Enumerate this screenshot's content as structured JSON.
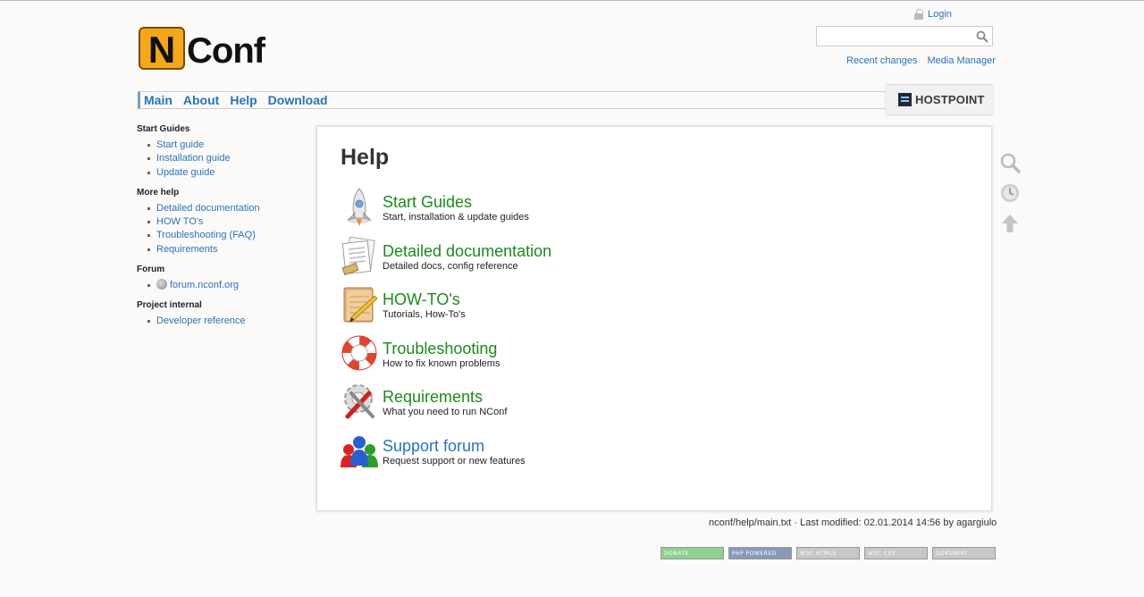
{
  "header": {
    "logo_text": "NConf",
    "login_label": "Login",
    "search": {
      "value": "",
      "placeholder": ""
    },
    "usertools": [
      "Recent changes",
      "Media Manager"
    ]
  },
  "menu": [
    "Main",
    "About",
    "Help",
    "Download"
  ],
  "sponsor": "HOSTPOINT",
  "sidebar": {
    "sections": [
      {
        "title": "Start Guides",
        "items": [
          "Start guide",
          "Installation guide",
          "Update guide"
        ]
      },
      {
        "title": "More help",
        "items": [
          "Detailed documentation",
          "HOW TO's",
          "Troubleshooting (FAQ)",
          "Requirements"
        ]
      },
      {
        "title": "Forum",
        "items": [
          "forum.nconf.org"
        ]
      },
      {
        "title": "Project internal",
        "items": [
          "Developer reference"
        ]
      }
    ]
  },
  "main": {
    "title": "Help",
    "entries": [
      {
        "title": "Start Guides",
        "subtitle": "Start, installation & update guides",
        "icon": "rocket-icon"
      },
      {
        "title": "Detailed documentation",
        "subtitle": "Detailed docs, config reference",
        "icon": "documents-icon"
      },
      {
        "title": "HOW-TO's",
        "subtitle": "Tutorials, How-To's",
        "icon": "notepad-icon"
      },
      {
        "title": "Troubleshooting",
        "subtitle": "How to fix known problems",
        "icon": "lifebuoy-icon"
      },
      {
        "title": "Requirements",
        "subtitle": "What you need to run NConf",
        "icon": "tools-icon"
      },
      {
        "title": "Support forum",
        "subtitle": "Request support or new features",
        "icon": "users-icon"
      }
    ]
  },
  "docinfo": "nconf/help/main.txt · Last modified: 02.01.2014 14:56 by agargiulo",
  "badges": [
    {
      "label": "DONATE",
      "color": "#8fcf8f"
    },
    {
      "label": "PHP POWERED",
      "color": "#8899bb"
    },
    {
      "label": "W3C HTML5",
      "color": "#c7c7c7"
    },
    {
      "label": "W3C CSS",
      "color": "#c7c7c7"
    },
    {
      "label": "DOKUWIKI",
      "color": "#c7c7c7"
    }
  ],
  "page_tools": [
    "search-icon",
    "recent-changes-icon",
    "back-to-top-icon"
  ]
}
